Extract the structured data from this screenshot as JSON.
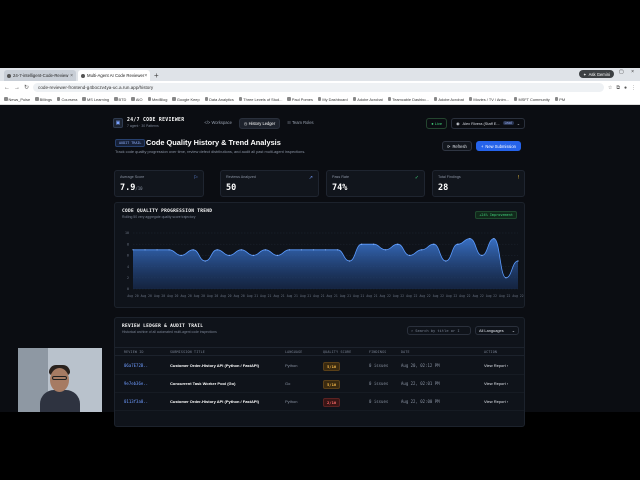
{
  "browser": {
    "tabs": [
      {
        "label": "24-7-intelligent-Code-Review",
        "active": false
      },
      {
        "label": "Multi-Agent AI Code Reviewer",
        "active": true
      }
    ],
    "ask_label": "Ask Gemini",
    "url": "code-reviewer-frontend-g4boczv4ya-uc.a.run.app/history",
    "bookmarks": [
      "News_Pulse",
      "Billings",
      "Coursera",
      "MS Learning",
      "BTD",
      "AIO",
      "MedBlog",
      "Google Keep",
      "Data Analytics",
      "Three Levels of Stud...",
      "Paul Pomes",
      "My Dashboard",
      "Adobe Acrobat",
      "Teamcable Dashbo...",
      "Adobe Acrobat",
      "Movies / TV / Anim...",
      "MSFT Community",
      "PM"
    ]
  },
  "app": {
    "brand_title": "24/7 CODE REVIEWER",
    "brand_sub": "7 agent · 30 Patterns",
    "nav": [
      {
        "label": "Workspace",
        "icon": "</>",
        "active": false
      },
      {
        "label": "History Ledger",
        "icon": "◷",
        "active": true
      },
      {
        "label": "Team Roles",
        "icon": "☷",
        "active": false
      }
    ],
    "live_label": "Live",
    "user_name": "Alex Rivera (Staff E...",
    "user_role": "Lead"
  },
  "page": {
    "crumb": "AUDIT TRAIL",
    "title": "Code Quality History & Trend Analysis",
    "subtitle": "Track code quality progression over time, review defect distributions, and audit all past multi-agent inspections.",
    "refresh_label": "Refresh",
    "new_label": "New Submission"
  },
  "stats": [
    {
      "label": "Average Score",
      "value": "7.9",
      "suffix": "/10",
      "icon": "⚐",
      "color": "#6e9bff"
    },
    {
      "label": "Reviews Analyzed",
      "value": "50",
      "suffix": "",
      "icon": "↗",
      "color": "#7aa2ff"
    },
    {
      "label": "Pass Rate",
      "value": "74%",
      "suffix": "",
      "icon": "✓",
      "color": "#41d17a"
    },
    {
      "label": "Total Findings",
      "value": "28",
      "suffix": "",
      "icon": "!",
      "color": "#f5c542"
    }
  ],
  "chart_title": "CODE QUALITY PROGRESSION TREND",
  "chart_sub": "Rolling 50 very aggregate quality score trajectory",
  "chart_badge": "+24% Improvement",
  "chart_data": {
    "type": "area",
    "x": [
      "Aug 20",
      "Aug 20",
      "Aug 20",
      "Aug 20",
      "Aug 20",
      "Aug 20",
      "Aug 20",
      "Aug 20",
      "Aug 20",
      "Aug 21",
      "Aug 21",
      "Aug 21",
      "Aug 21",
      "Aug 21",
      "Aug 21",
      "Aug 21",
      "Aug 21",
      "Aug 21",
      "Aug 21",
      "Aug 22",
      "Aug 22",
      "Aug 22",
      "Aug 22",
      "Aug 22",
      "Aug 22",
      "Aug 22",
      "Aug 22",
      "Aug 22",
      "Aug 22",
      "Aug 22"
    ],
    "values": [
      7,
      7,
      7,
      7,
      6,
      7,
      5,
      7,
      6,
      7,
      6,
      7,
      6,
      7,
      7,
      7,
      7,
      7,
      5,
      8,
      8,
      7,
      8,
      6,
      7,
      8,
      5,
      8,
      9,
      6,
      9,
      2,
      5
    ],
    "ylim": [
      0,
      10
    ],
    "yticks": [
      0,
      2,
      4,
      6,
      8,
      10
    ],
    "grid": true
  },
  "ledger": {
    "title": "REVIEW LEDGER & AUDIT TRAIL",
    "subtitle": "Historical archive of all automated multi-agent code inspections",
    "search_placeholder": "Search by title or I",
    "language_filter": "All Languages",
    "columns": [
      "REVIEW ID",
      "SUBMISSION TITLE",
      "LANGUAGE",
      "QUALITY SCORE",
      "FINDINGS",
      "DATE",
      "ACTION"
    ],
    "rows": [
      {
        "id": "06a7E72B..",
        "title": "Customer Order-History API (Python / FastAPI)",
        "language": "Python",
        "score": "5/10",
        "level": "warn",
        "findings": "0 issues",
        "date": "Aug 20, 02:12 PM",
        "action": "View Report ›"
      },
      {
        "id": "9e7eb36e..",
        "title": "Concurrent Task Worker Pool (Go)",
        "language": "Go",
        "score": "5/10",
        "level": "warn",
        "findings": "0 issues",
        "date": "Aug 22, 02:01 PM",
        "action": "View Report ›"
      },
      {
        "id": "0113f3a0..",
        "title": "Customer Order-History API (Python / FastAPI)",
        "language": "Python",
        "score": "2/10",
        "level": "bad",
        "findings": "0 issues",
        "date": "Aug 22, 02:00 PM",
        "action": "View Report ›"
      }
    ]
  }
}
